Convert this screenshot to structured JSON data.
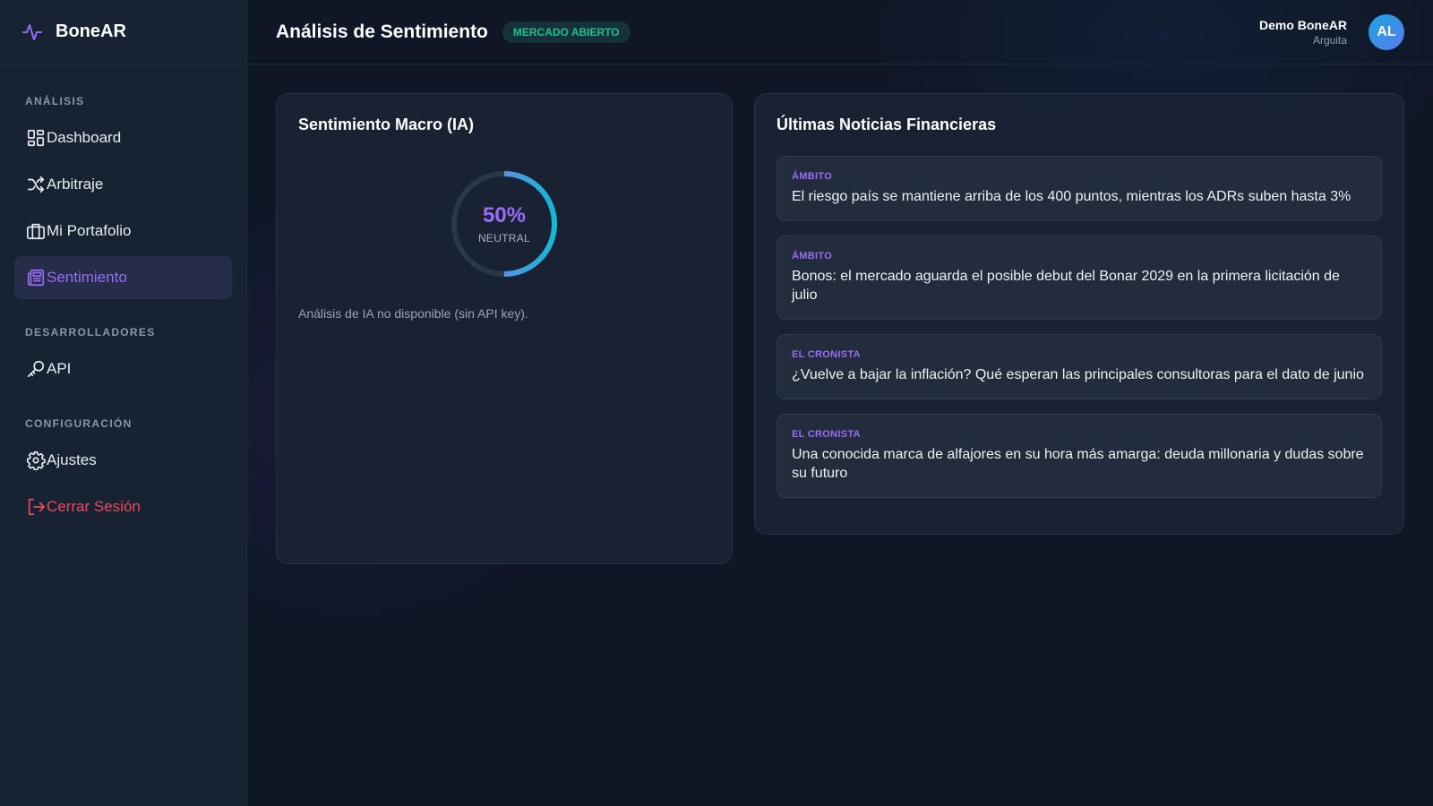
{
  "brand": {
    "name": "BoneAR",
    "icon": "activity-icon",
    "accent": "#9b6cf5"
  },
  "sidebar": {
    "sections": [
      {
        "title": "ANÁLISIS",
        "items": [
          {
            "label": "Dashboard",
            "icon": "dashboard-icon"
          },
          {
            "label": "Arbitraje",
            "icon": "shuffle-icon"
          },
          {
            "label": "Mi Portafolio",
            "icon": "briefcase-icon"
          },
          {
            "label": "Sentimiento",
            "icon": "newspaper-icon",
            "active": true
          }
        ]
      },
      {
        "title": "DESARROLLADORES",
        "items": [
          {
            "label": "API",
            "icon": "key-icon"
          }
        ]
      },
      {
        "title": "CONFIGURACIÓN",
        "items": [
          {
            "label": "Ajustes",
            "icon": "gear-icon"
          },
          {
            "label": "Cerrar Sesión",
            "icon": "logout-icon",
            "danger": true
          }
        ]
      }
    ]
  },
  "header": {
    "title": "Análisis de Sentimiento",
    "market_status": "MERCADO ABIERTO",
    "user": {
      "name": "Demo BoneAR",
      "org": "Arguita",
      "initials": "AL"
    }
  },
  "sentiment": {
    "title": "Sentimiento Macro (IA)",
    "value": 50,
    "value_text": "50%",
    "label": "NEUTRAL",
    "note": "Análisis de IA no disponible (sin API key).",
    "colors": {
      "start": "#9b6cf5",
      "end": "#14b8d4",
      "track": "#2b3647"
    }
  },
  "news": {
    "title": "Últimas Noticias Financieras",
    "items": [
      {
        "source": "ÁMBITO",
        "headline": "El riesgo país se mantiene arriba de los 400 puntos, mientras los ADRs suben hasta 3%"
      },
      {
        "source": "ÁMBITO",
        "headline": "Bonos: el mercado aguarda el posible debut del Bonar 2029 en la primera licitación de julio"
      },
      {
        "source": "EL CRONISTA",
        "headline": "¿Vuelve a bajar la inflación? Qué esperan las principales consultoras para el dato de junio"
      },
      {
        "source": "EL CRONISTA",
        "headline": "Una conocida marca de alfajores en su hora más amarga: deuda millonaria y dudas sobre su futuro"
      }
    ]
  }
}
